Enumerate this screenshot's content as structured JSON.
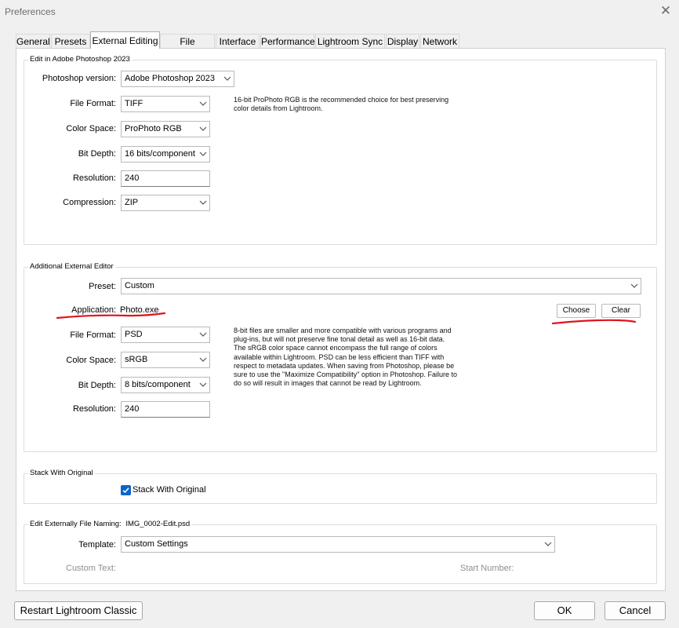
{
  "window": {
    "title": "Preferences"
  },
  "tabs": [
    "General",
    "Presets",
    "External Editing",
    "File Handling",
    "Interface",
    "Performance",
    "Lightroom Sync",
    "Display",
    "Network"
  ],
  "photoshop_group": {
    "title": "Edit in Adobe Photoshop 2023",
    "version_label": "Photoshop version:",
    "version_value": "Adobe Photoshop 2023",
    "format_label": "File Format:",
    "format_value": "TIFF",
    "color_label": "Color Space:",
    "color_value": "ProPhoto RGB",
    "depth_label": "Bit Depth:",
    "depth_value": "16 bits/component",
    "resolution_label": "Resolution:",
    "resolution_value": "240",
    "compression_label": "Compression:",
    "compression_value": "ZIP",
    "note": [
      "16-bit ProPhoto RGB is the recommended choice for best preserving",
      "color details from Lightroom."
    ]
  },
  "additional_group": {
    "title": "Additional External Editor",
    "preset_label": "Preset:",
    "preset_value": "Custom",
    "application_label": "Application:",
    "application_value": "Photo.exe",
    "choose_label": "Choose",
    "clear_label": "Clear",
    "format_label": "File Format:",
    "format_value": "PSD",
    "color_label": "Color Space:",
    "color_value": "sRGB",
    "depth_label": "Bit Depth:",
    "depth_value": "8 bits/component",
    "resolution_label": "Resolution:",
    "resolution_value": "240",
    "note": [
      "8-bit files are smaller and more compatible with various programs and",
      "plug-ins, but will not preserve fine tonal detail as well as 16-bit data.",
      "The sRGB color space cannot encompass the full range of colors",
      "available within Lightroom. PSD can be less efficient than TIFF with",
      "respect to metadata updates. When saving from Photoshop, please be",
      "sure to use the \"Maximize Compatibility\" option in Photoshop. Failure to",
      "do so will result in images that cannot be read by Lightroom."
    ]
  },
  "stack_group": {
    "title": "Stack With Original",
    "checkbox_label": "Stack With Original",
    "checked": true
  },
  "naming_group": {
    "title": "Edit Externally File Naming:",
    "example": "IMG_0002-Edit.psd",
    "template_label": "Template:",
    "template_value": "Custom Settings",
    "custom_text_label": "Custom Text:",
    "start_number_label": "Start Number:"
  },
  "footer": {
    "restart_label": "Restart Lightroom Classic",
    "ok_label": "OK",
    "cancel_label": "Cancel"
  },
  "colors": {
    "accent": "#0d63c9",
    "annotation": "#e0141c"
  }
}
